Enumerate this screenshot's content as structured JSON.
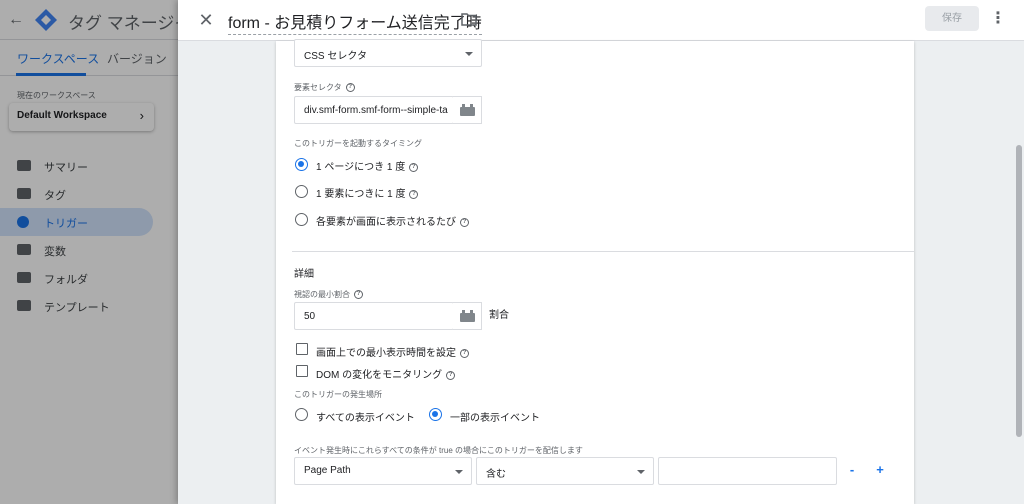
{
  "background_app": {
    "back_icon": "arrow-left-icon",
    "logo_icon": "gtm-logo",
    "title": "タグ マネージャ",
    "tabs": [
      "ワークスペース",
      "バージョン"
    ],
    "workspace_label": "現在のワークスペース",
    "workspace_name": "Default Workspace",
    "nav_items": [
      {
        "label": "サマリー",
        "icon": "summary-icon"
      },
      {
        "label": "タグ",
        "icon": "tag-icon"
      },
      {
        "label": "トリガー",
        "icon": "trigger-icon",
        "active": true
      },
      {
        "label": "変数",
        "icon": "variable-icon"
      },
      {
        "label": "フォルダ",
        "icon": "folder-icon"
      },
      {
        "label": "テンプレート",
        "icon": "template-icon"
      }
    ]
  },
  "sheet": {
    "close_icon": "close-icon",
    "title": "form - お見積りフォーム送信完了時",
    "folder_icon": "folder-icon",
    "save_label": "保存",
    "more_icon": "more-vert-icon"
  },
  "trigger": {
    "selection_method": "CSS セレクタ",
    "element_selector_label": "要素セレクタ",
    "element_selector_value": "div.smf-form.smf-form--simple-ta",
    "timing_label": "このトリガーを起動するタイミング",
    "timing_options": [
      {
        "label": "1 ページにつき 1 度",
        "selected": true
      },
      {
        "label": "1 要素につきに 1 度",
        "selected": false
      },
      {
        "label": "各要素が画面に表示されるたび",
        "selected": false
      }
    ],
    "advanced_title": "詳細",
    "min_visible_label": "視認の最小割合",
    "min_visible_value": "50",
    "min_visible_unit": "割合",
    "checkbox_min_time": "画面上での最小表示時間を設定",
    "checkbox_dom": "DOM の変化をモニタリング",
    "fires_on_label": "このトリガーの発生場所",
    "fires_on_options": [
      {
        "label": "すべての表示イベント",
        "selected": false
      },
      {
        "label": "一部の表示イベント",
        "selected": true
      }
    ],
    "condition_label": "イベント発生時にこれらすべての条件が true の場合にこのトリガーを配信します",
    "condition": {
      "variable": "Page Path",
      "operator": "含む",
      "value": ""
    },
    "remove_label": "-",
    "add_label": "+"
  },
  "colors": {
    "accent": "#1a73e8",
    "text": "#202124",
    "muted": "#5f6368"
  }
}
